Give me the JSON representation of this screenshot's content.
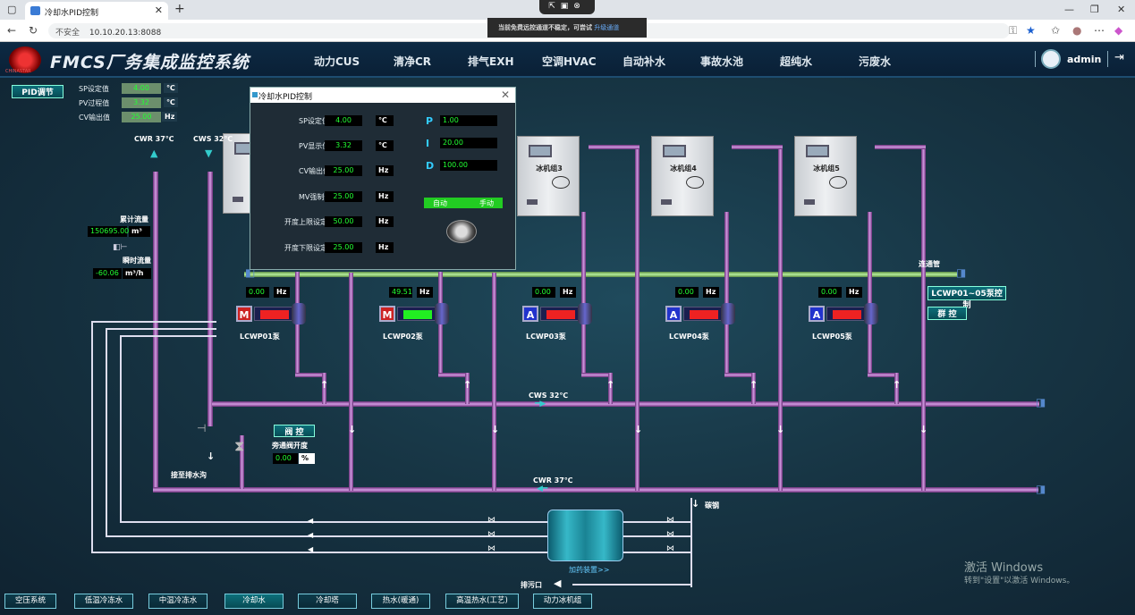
{
  "browser": {
    "tab_title": "冷却水PID控制",
    "url_insecure": "不安全",
    "url": "10.10.20.13:8088",
    "remote_notice": "当前免费远控通道不稳定，可尝试",
    "remote_upgrade": "升级通道"
  },
  "app": {
    "title": "FMCS厂务集成监控系统",
    "logo_text": "CHINASTAR",
    "nav": [
      "动力CUS",
      "清净CR",
      "排气EXH",
      "空调HVAC",
      "自动补水",
      "事故水池",
      "超纯水",
      "污废水"
    ],
    "user": "admin"
  },
  "pid_button": "PID调节",
  "summary": {
    "sp_label": "SP设定值",
    "sp_value": "4.00",
    "sp_unit": "℃",
    "pv_label": "PV过程值",
    "pv_value": "3.32",
    "pv_unit": "℃",
    "cv_label": "CV输出值",
    "cv_value": "25.00",
    "cv_unit": "Hz"
  },
  "dialog": {
    "title": "冷却水PID控制",
    "rows": [
      {
        "label": "SP设定值",
        "value": "4.00",
        "unit": "℃"
      },
      {
        "label": "PV显示值",
        "value": "3.32",
        "unit": "℃"
      },
      {
        "label": "CV输出值",
        "value": "25.00",
        "unit": "Hz"
      },
      {
        "label": "MV强制值",
        "value": "25.00",
        "unit": "Hz"
      },
      {
        "label": "开度上限设定",
        "value": "50.00",
        "unit": "Hz"
      },
      {
        "label": "开度下限设定",
        "value": "25.00",
        "unit": "Hz"
      }
    ],
    "p_label": "P",
    "p_value": "1.00",
    "i_label": "I",
    "i_value": "20.00",
    "d_label": "D",
    "d_value": "100.00",
    "auto": "自动",
    "manual": "手动"
  },
  "flow": {
    "total_label": "累计流量",
    "total_value": "150695.00",
    "total_unit": "m³",
    "inst_label": "瞬时流量",
    "inst_value": "-60.06",
    "inst_unit": "m³/h"
  },
  "labels": {
    "cwr_top": "CWR 37℃",
    "cws_top": "CWS 32℃",
    "cws_mid": "CWS 32℃",
    "cwr_bottom": "CWR 37℃",
    "connector": "连通管",
    "drain": "接至排水沟",
    "carbon_steel": "碳钢",
    "dosing": "加药装置>>",
    "sewage": "排污口",
    "valve_btn": "阀 控",
    "bypass_label": "旁通阀开度",
    "bypass_value": "0.00",
    "bypass_unit": "%",
    "group_btn": "LCWP01~05泵控制",
    "group_ctrl": "群 控"
  },
  "chillers": [
    "冰机组3",
    "冰机组4",
    "冰机组5"
  ],
  "pumps": [
    {
      "name": "LCWP01泵",
      "freq": "0.00",
      "unit": "Hz",
      "mode": "M",
      "running": false
    },
    {
      "name": "LCWP02泵",
      "freq": "49.51",
      "unit": "Hz",
      "mode": "M",
      "running": true
    },
    {
      "name": "LCWP03泵",
      "freq": "0.00",
      "unit": "Hz",
      "mode": "A",
      "running": false
    },
    {
      "name": "LCWP04泵",
      "freq": "0.00",
      "unit": "Hz",
      "mode": "A",
      "running": false
    },
    {
      "name": "LCWP05泵",
      "freq": "0.00",
      "unit": "Hz",
      "mode": "A",
      "running": false
    }
  ],
  "bottom_nav": [
    "空压系统",
    "低温冷冻水",
    "中温冷冻水",
    "冷却水",
    "冷却塔",
    "热水(暖通)",
    "高温热水(工艺)",
    "动力冰机组"
  ],
  "watermark": {
    "line1": "激活 Windows",
    "line2": "转到\"设置\"以激活 Windows。"
  }
}
